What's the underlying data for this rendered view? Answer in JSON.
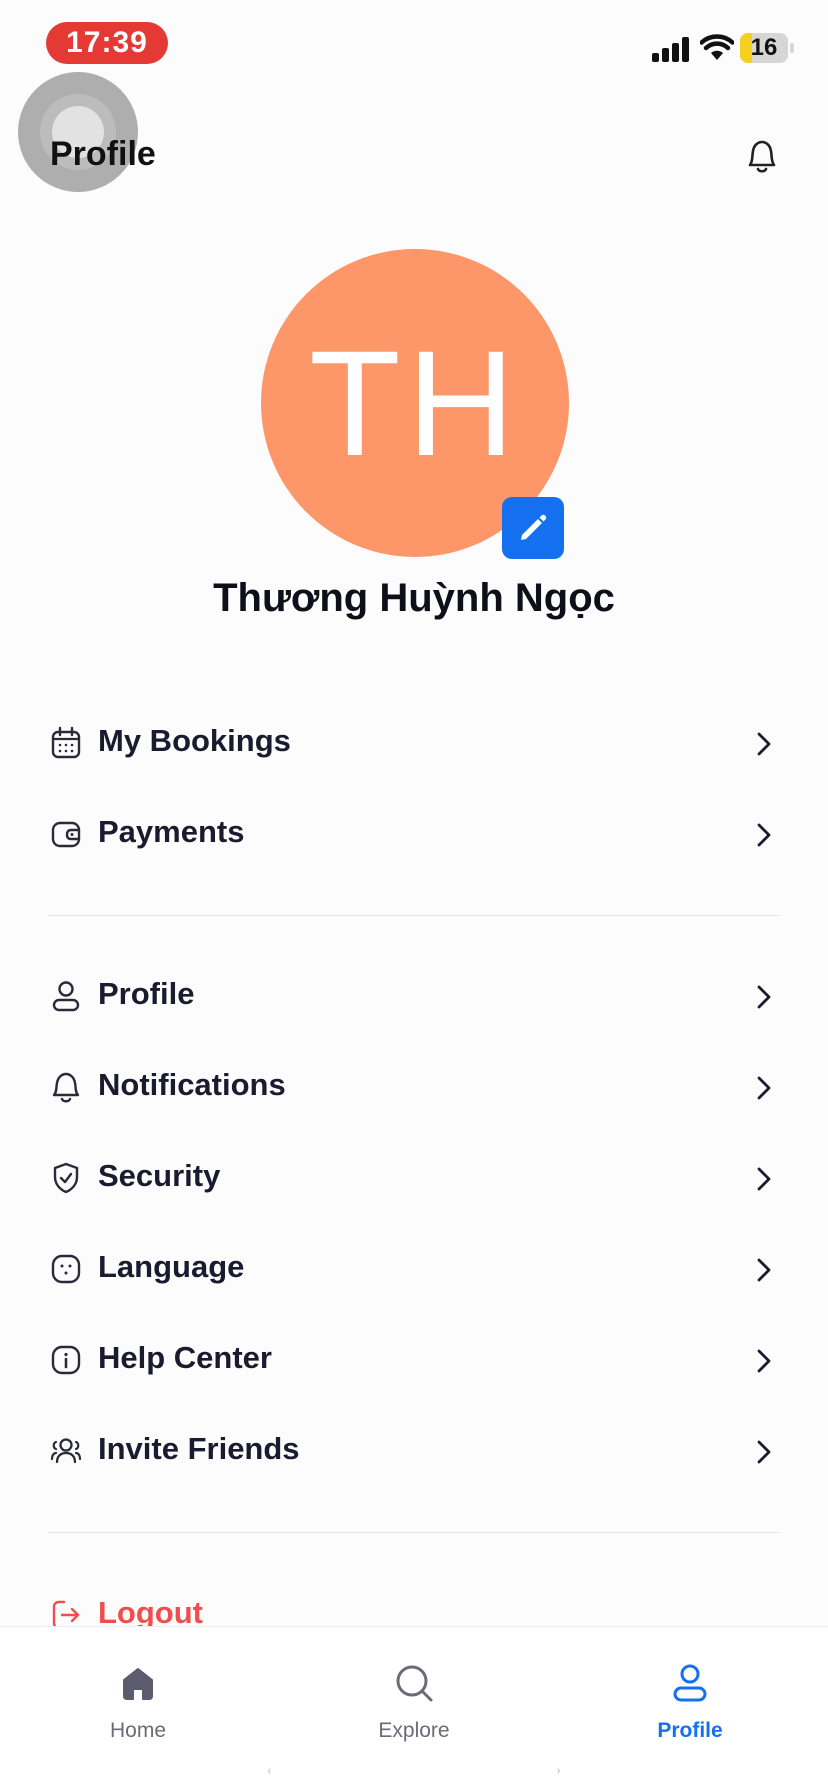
{
  "status_bar": {
    "time": "17:39",
    "battery": "16",
    "time_color": "#e53935",
    "battery_fill_color": "#f5d020"
  },
  "header": {
    "title": "Profile"
  },
  "profile": {
    "initials": "TH",
    "name": "Thương Huỳnh Ngọc",
    "avatar_color": "#fd9668"
  },
  "menu": {
    "group1": [
      {
        "label": "My Bookings",
        "icon": "calendar-icon"
      },
      {
        "label": "Payments",
        "icon": "wallet-icon"
      }
    ],
    "group2": [
      {
        "label": "Profile",
        "icon": "user-icon"
      },
      {
        "label": "Notifications",
        "icon": "bell-icon"
      },
      {
        "label": "Security",
        "icon": "shield-check-icon"
      },
      {
        "label": "Language",
        "icon": "language-icon"
      },
      {
        "label": "Help Center",
        "icon": "info-icon"
      },
      {
        "label": "Invite Friends",
        "icon": "users-icon"
      }
    ],
    "logout": {
      "label": "Logout",
      "icon": "logout-icon",
      "color": "#f04e4e"
    }
  },
  "bottom_nav": [
    {
      "label": "Home",
      "icon": "home-icon"
    },
    {
      "label": "Explore",
      "icon": "search-icon"
    },
    {
      "label": "Profile",
      "icon": "user-icon",
      "active": true
    }
  ],
  "colors": {
    "accent": "#1570ef",
    "text": "#1b1b2f",
    "danger": "#f04e4e"
  }
}
